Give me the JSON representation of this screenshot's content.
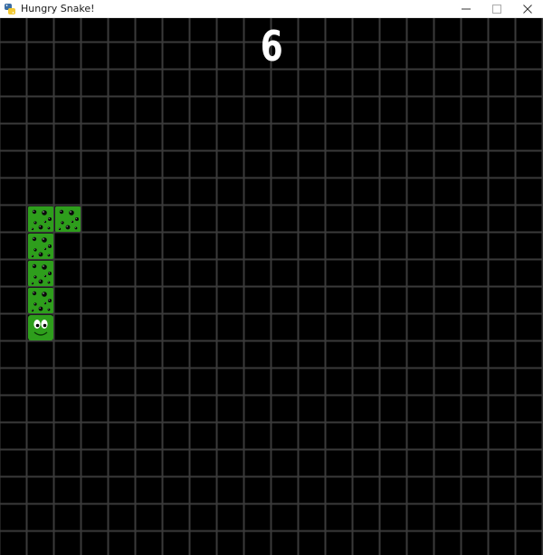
{
  "window": {
    "title": "Hungry Snake!",
    "controls": [
      "minimize",
      "maximize",
      "close"
    ]
  },
  "game": {
    "score": "6",
    "grid_columns": 20,
    "snake": {
      "color": "#2e9e1c",
      "spot_color": "#0a0a0a",
      "head_direction": "down",
      "segments_cells": [
        {
          "col": 2,
          "row": 7
        },
        {
          "col": 1,
          "row": 7
        },
        {
          "col": 1,
          "row": 8
        },
        {
          "col": 1,
          "row": 9
        },
        {
          "col": 1,
          "row": 10
        },
        {
          "col": 1,
          "row": 11
        }
      ]
    },
    "colors": {
      "background": "#000000",
      "grid_line": "#3a3a3a",
      "score_text": "#ffffff"
    }
  }
}
